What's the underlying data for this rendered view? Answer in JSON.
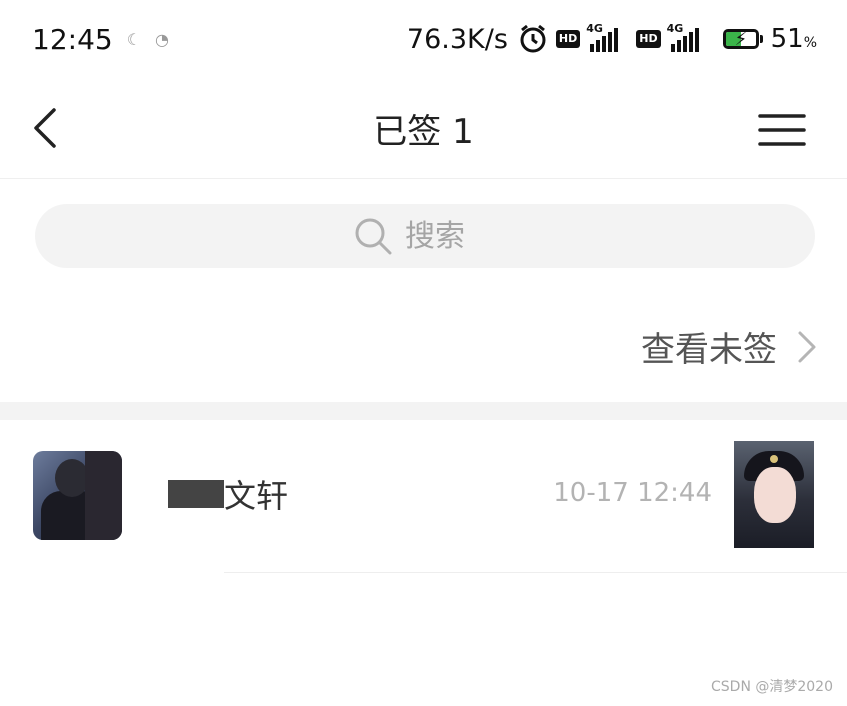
{
  "status_bar": {
    "time": "12:45",
    "network_speed": "76.3K/s",
    "sim1_badge": "HD",
    "sim1_network": "4G",
    "sim2_badge": "HD",
    "sim2_network": "4G",
    "battery_percent": "51",
    "battery_percent_unit": "%",
    "icons": [
      "moon-icon",
      "notification-icon",
      "alarm-icon",
      "signal-icon",
      "battery-charging-icon"
    ]
  },
  "nav": {
    "title": "已签 1",
    "back_icon": "chevron-left-icon",
    "menu_icon": "hamburger-menu-icon"
  },
  "search": {
    "placeholder": "搜索",
    "icon": "search-icon"
  },
  "unsigned_link": {
    "label": "查看未签",
    "icon": "chevron-right-icon"
  },
  "signed_list": [
    {
      "name_visible": "文轩",
      "timestamp": "10-17 12:44",
      "avatar_icon": "avatar",
      "signature_image": "signature-thumbnail"
    }
  ],
  "watermark": "CSDN @清梦2020",
  "colors": {
    "background": "#ffffff",
    "search_bg": "#f3f3f3",
    "muted_text": "#b3b3b3",
    "battery_fill": "#3bb54a"
  }
}
